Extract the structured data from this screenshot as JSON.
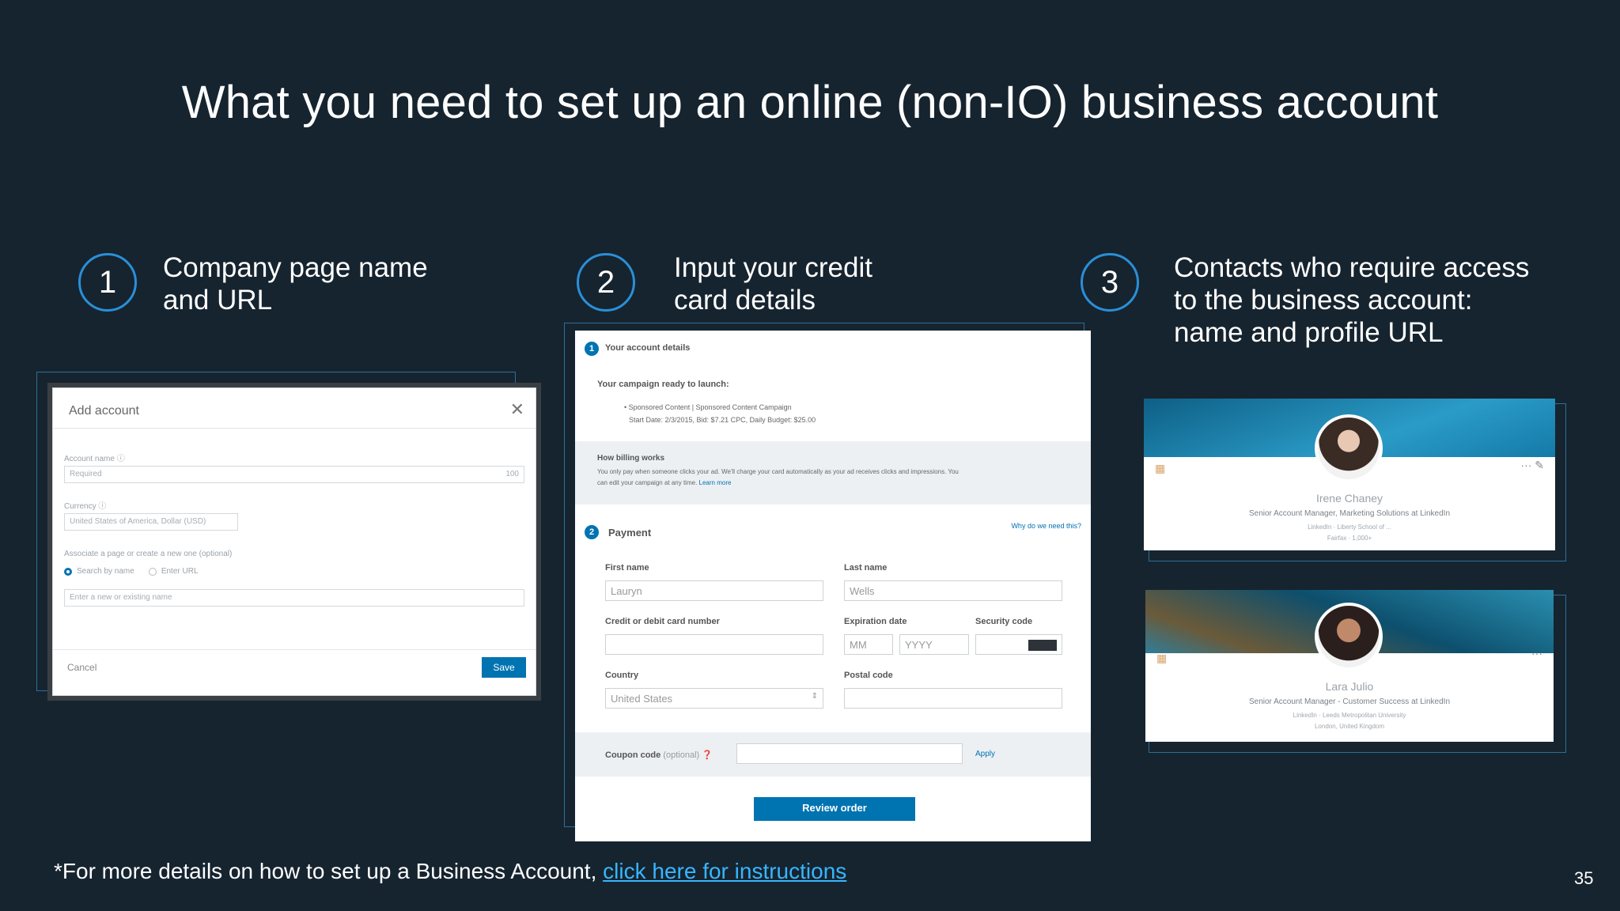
{
  "slide": {
    "title": "What you need to set up an online (non-IO) business account",
    "page_number": "35"
  },
  "steps": [
    {
      "number": "1",
      "text_line1": "Company page name",
      "text_line2": "and URL",
      "text_line3": ""
    },
    {
      "number": "2",
      "text_line1": "Input your credit",
      "text_line2": "card details",
      "text_line3": ""
    },
    {
      "number": "3",
      "text_line1": "Contacts who require access",
      "text_line2": "to the business account:",
      "text_line3": "name and profile URL"
    }
  ],
  "add_account": {
    "title": "Add account",
    "account_name_label": "Account name",
    "account_name_placeholder": "Required",
    "account_name_counter": "100",
    "currency_label": "Currency",
    "currency_value": "United States of America, Dollar (USD)",
    "associate_label": "Associate a page or create a new one (optional)",
    "radio_search": "Search by name",
    "radio_url": "Enter URL",
    "page_search_placeholder": "Enter a new or existing name",
    "cancel_label": "Cancel",
    "save_label": "Save"
  },
  "payment": {
    "account_details_title": "Your account details",
    "campaign_ready": "Your campaign ready to launch:",
    "campaign_line1": "• Sponsored Content | Sponsored Content Campaign",
    "campaign_line2": "Start Date: 2/3/2015, Bid: $7.21 CPC, Daily Budget: $25.00",
    "billing_title": "How billing works",
    "billing_line1": "You only pay when someone clicks your ad. We'll charge your card automatically as your ad receives clicks and impressions. You",
    "billing_line2": "can edit your campaign at any time.",
    "learn_more": "Learn more",
    "payment_title": "Payment",
    "why_link": "Why do we need this?",
    "first_name_label": "First name",
    "first_name_value": "Lauryn",
    "last_name_label": "Last name",
    "last_name_value": "Wells",
    "card_label": "Credit or debit card number",
    "expiry_label": "Expiration date",
    "expiry_mm": "MM",
    "expiry_yyyy": "YYYY",
    "security_label": "Security code",
    "country_label": "Country",
    "country_value": "United States",
    "postal_label": "Postal code",
    "coupon_label": "Coupon code",
    "coupon_optional": "(optional)",
    "apply_label": "Apply",
    "review_label": "Review order"
  },
  "profiles": [
    {
      "name": "Irene Chaney",
      "title": "Senior Account Manager, Marketing Solutions at LinkedIn",
      "sub1": "LinkedIn · Liberty School of ...",
      "sub2": "Fairfax · 1,000+"
    },
    {
      "name": "Lara Julio",
      "title": "Senior Account Manager - Customer Success at LinkedIn",
      "sub1": "LinkedIn · Leeds Metropolitan University",
      "sub2": "London, United Kingdom"
    }
  ],
  "footer": {
    "prefix": "*For more details on how to set up a Business Account, ",
    "link_text": "click here for instructions"
  },
  "colors": {
    "background": "#16242f",
    "accent": "#2a8fd8",
    "link": "#37b6ff",
    "button": "#0073b1"
  }
}
